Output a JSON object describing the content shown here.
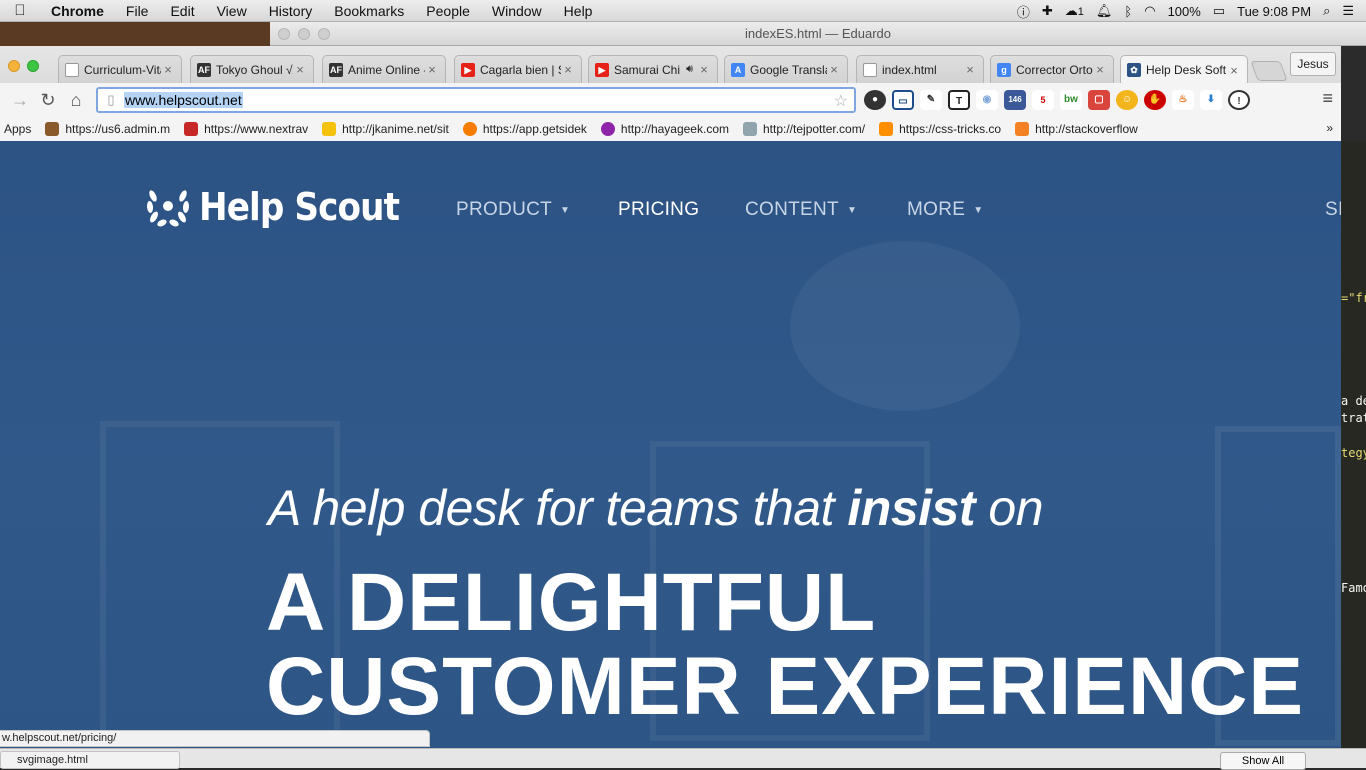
{
  "menubar": {
    "app": "Chrome",
    "items": [
      "File",
      "Edit",
      "View",
      "History",
      "Bookmarks",
      "People",
      "Window",
      "Help"
    ],
    "battery": "100%",
    "clock": "Tue 9:08 PM",
    "badge": "1"
  },
  "background_window": {
    "title": "indexES.html — Eduardo"
  },
  "tabs": [
    {
      "label": "Curriculum-Vita",
      "color": "#ffffff",
      "icon": "page-icon"
    },
    {
      "label": "Tokyo Ghoul √A",
      "color": "#333333",
      "icon": "AF"
    },
    {
      "label": "Anime Online -",
      "color": "#333333",
      "icon": "AF"
    },
    {
      "label": "Cagarla bien | S",
      "color": "#e62117",
      "icon": "youtube-icon"
    },
    {
      "label": "Samurai Chi",
      "color": "#e62117",
      "icon": "youtube-icon"
    },
    {
      "label": "Google Transla",
      "color": "#4285f4",
      "icon": "translate-icon"
    },
    {
      "label": "index.html",
      "color": "#ffffff",
      "icon": "page-icon"
    },
    {
      "label": "Corrector Ortog",
      "color": "#4285f4",
      "icon": "google-icon"
    },
    {
      "label": "Help Desk Soft",
      "color": "#2c5384",
      "icon": "helpscout-icon"
    }
  ],
  "profile": "Jesus",
  "omnibox": {
    "url": "www.helpscout.net"
  },
  "extensions": [
    {
      "name": "colorzilla-icon",
      "color": "#333333",
      "text": ""
    },
    {
      "name": "screenshot-icon",
      "color": "#1e4d8c",
      "text": ""
    },
    {
      "name": "eyedropper-icon",
      "color": "#555555",
      "text": ""
    },
    {
      "name": "text-icon",
      "color": "#222222",
      "text": "T"
    },
    {
      "name": "camera-icon",
      "color": "#7fa7d8",
      "text": ""
    },
    {
      "name": "like-icon",
      "color": "#3b5998",
      "text": "146"
    },
    {
      "name": "stack-icon",
      "color": "#6aa84f",
      "text": "5"
    },
    {
      "name": "bw-icon",
      "color": "#2e8b2e",
      "text": "bw"
    },
    {
      "name": "pocket-icon",
      "color": "#d9443c",
      "text": ""
    },
    {
      "name": "emoji-icon",
      "color": "#f2b51b",
      "text": ""
    },
    {
      "name": "adblock-icon",
      "color": "#cc0000",
      "text": ""
    },
    {
      "name": "fire-icon",
      "color": "#e8711c",
      "text": ""
    },
    {
      "name": "download-icon",
      "color": "#2a7fd4",
      "text": ""
    },
    {
      "name": "info-icon",
      "color": "#555555",
      "text": ""
    }
  ],
  "bookmarks": [
    {
      "label": "Apps",
      "color": ""
    },
    {
      "label": "https://us6.admin.m",
      "color": "#8a5a2b"
    },
    {
      "label": "https://www.nextrav",
      "color": "#c62828"
    },
    {
      "label": "http://jkanime.net/sit",
      "color": "#f4c20d"
    },
    {
      "label": "https://app.getsidek",
      "color": "#f57c00"
    },
    {
      "label": "http://hayageek.com",
      "color": "#8e24aa"
    },
    {
      "label": "http://tejpotter.com/",
      "color": "#90a4ae"
    },
    {
      "label": "https://css-tricks.co",
      "color": "#ff8f00"
    },
    {
      "label": "http://stackoverflow",
      "color": "#f48024"
    }
  ],
  "bookmarks_more": "»",
  "page": {
    "brand": "Help Scout",
    "nav": [
      {
        "label": "PRODUCT",
        "caret": "▼"
      },
      {
        "label": "PRICING",
        "caret": ""
      },
      {
        "label": "CONTENT",
        "caret": "▼"
      },
      {
        "label": "MORE",
        "caret": "▼"
      },
      {
        "label": "SI",
        "caret": ""
      }
    ],
    "tagline_pre": "A help desk for teams that ",
    "tagline_bold": "insist",
    "tagline_post": " on",
    "headline_line1": "A DELIGHTFUL",
    "headline_line2": "CUSTOMER EXPERIENCE"
  },
  "code_fragments": [
    "=\"fr",
    "a de",
    "trat",
    "tegy",
    "Famo"
  ],
  "status_url": "w.helpscout.net/pricing/",
  "download": {
    "file": "svgimage.html",
    "show_all": "Show All"
  }
}
